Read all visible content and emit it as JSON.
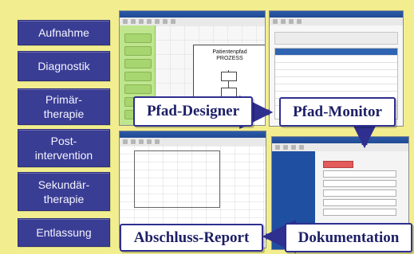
{
  "steps": [
    {
      "id": "aufnahme",
      "label": "Aufnahme"
    },
    {
      "id": "diagnostik",
      "label": "Diagnostik"
    },
    {
      "id": "primaertherapie",
      "label": "Primär-\ntherapie"
    },
    {
      "id": "postintervention",
      "label": "Post-\nintervention"
    },
    {
      "id": "sekundaertherapie",
      "label": "Sekundär-\ntherapie"
    },
    {
      "id": "entlassung",
      "label": "Entlassung"
    }
  ],
  "labels": {
    "pfad_designer": "Pfad-Designer",
    "pfad_monitor": "Pfad-Monitor",
    "dokumentation": "Dokumentation",
    "abschluss_report": "Abschluss-Report"
  },
  "colors": {
    "background": "#f2ee8f",
    "step_fill": "#3a3d94",
    "label_border": "#2e2f8e",
    "arrow": "#2e2f8e"
  },
  "screenshots": {
    "designer_title": "Patientenpfad\nPROZESS"
  }
}
